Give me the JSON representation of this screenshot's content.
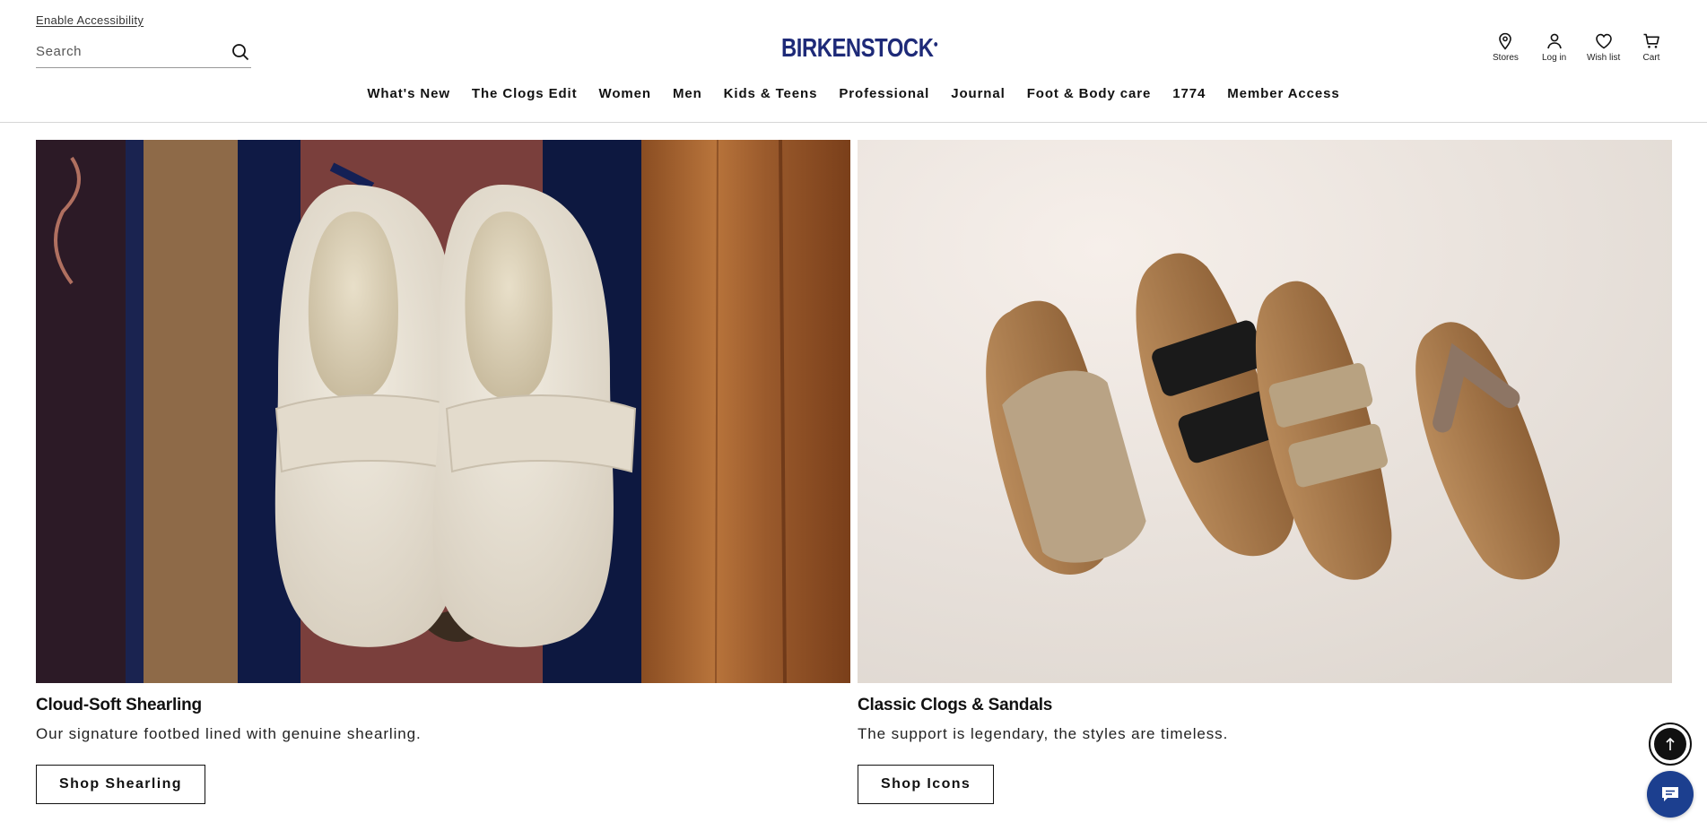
{
  "header": {
    "accessibility_link": "Enable Accessibility",
    "search_placeholder": "Search",
    "logo_text": "BIRKENSTOCK",
    "utilities": [
      {
        "label": "Stores",
        "icon": "location-pin-icon"
      },
      {
        "label": "Log in",
        "icon": "user-icon"
      },
      {
        "label": "Wish list",
        "icon": "heart-icon"
      },
      {
        "label": "Cart",
        "icon": "cart-icon"
      }
    ]
  },
  "nav": {
    "items": [
      "What's New",
      "The Clogs Edit",
      "Women",
      "Men",
      "Kids & Teens",
      "Professional",
      "Journal",
      "Foot & Body care",
      "1774",
      "Member Access"
    ]
  },
  "promos": [
    {
      "title": "Cloud-Soft Shearling",
      "subtitle": "Our signature footbed lined with genuine shearling.",
      "button": "Shop Shearling"
    },
    {
      "title": "Classic Clogs & Sandals",
      "subtitle": "The support is legendary, the styles are timeless.",
      "button": "Shop Icons"
    }
  ],
  "colors": {
    "brand_blue": "#1e2a78",
    "chat_blue": "#1c3f8f"
  }
}
